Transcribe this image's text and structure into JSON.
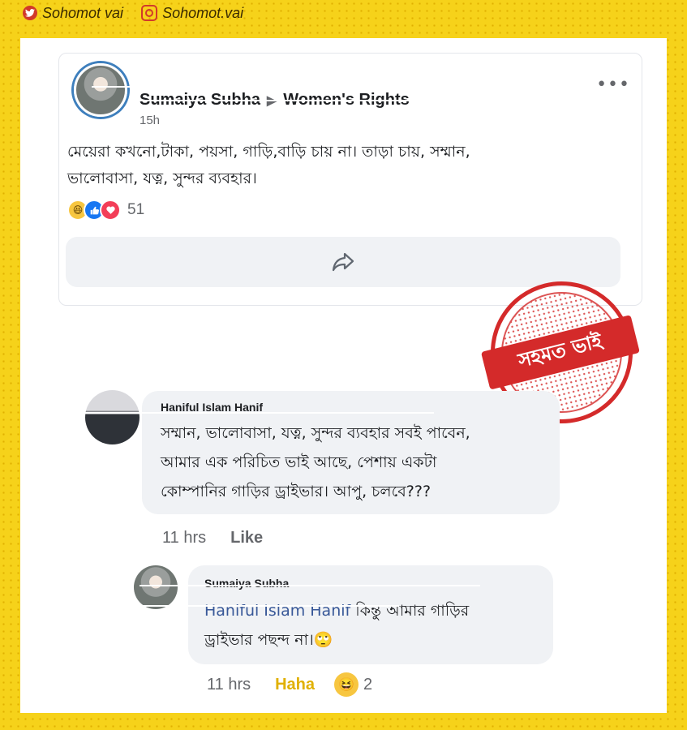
{
  "watermark": {
    "twitter_handle": "Sohomot vai",
    "instagram_handle": "Sohomot.vai"
  },
  "post": {
    "author": "Sumaiya Subha",
    "group": "Women's Rights",
    "time": "15h",
    "text_line1": "মেয়েরা  কখনো,টাকা, পয়সা, গাড়ি,বাড়ি চায় না। তাড়া  চায়, সম্মান,",
    "text_line2": "ভালোবাসা, যত্ন, সুন্দর ব্যবহার।",
    "reaction_count": "51"
  },
  "stamp": {
    "text": "সহমত ভাই"
  },
  "comments": [
    {
      "author": "Haniful Islam Hanif",
      "lines": [
        "সম্মান, ভালোবাসা, যত্ন, সুন্দর ব্যবহার সবই পাবেন,",
        "আমার এক পরিচিত ভাই আছে,  পেশায়  একটা",
        "কোম্পানির গাড়ির ড্রাইভার।   আপু, চলবে???"
      ],
      "time": "11 hrs",
      "like_label": "Like"
    },
    {
      "author": "Sumaiya Subha",
      "mention": "Haniful Islam Hanif",
      "line1_rest": " কিন্তু আমার গাড়ির",
      "line2": "ড্রাইভার পছন্দ না।🙄",
      "time": "11 hrs",
      "reaction_label": "Haha",
      "reaction_count": "2"
    }
  ]
}
